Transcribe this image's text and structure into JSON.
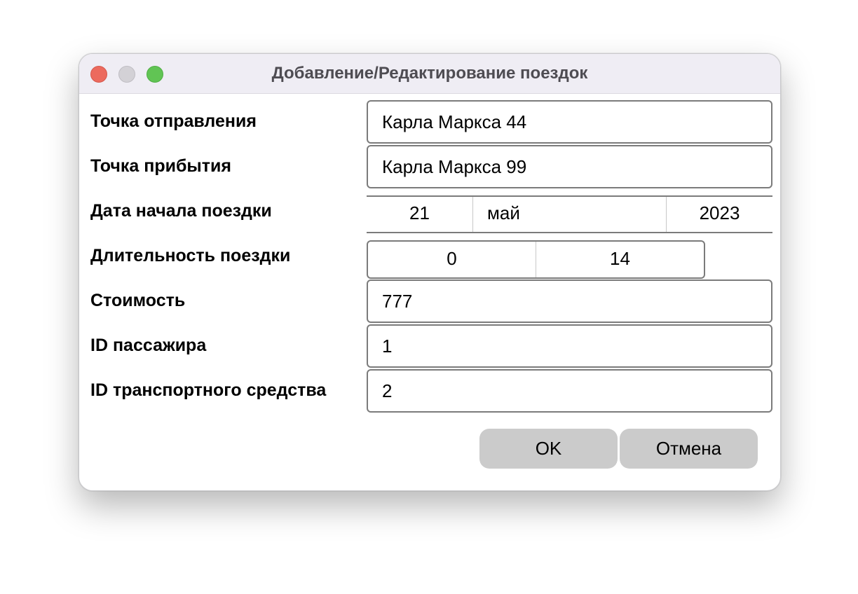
{
  "window": {
    "title": "Добавление/Редактирование поездок"
  },
  "form": {
    "departure": {
      "label": "Точка отправления",
      "value": "Карла Маркса 44"
    },
    "arrival": {
      "label": "Точка прибытия",
      "value": "Карла Маркса 99"
    },
    "start_date": {
      "label": "Дата начала поездки",
      "day": "21",
      "month": "май",
      "year": "2023"
    },
    "duration": {
      "label": "Длительность поездки",
      "first": "0",
      "second": "14"
    },
    "cost": {
      "label": "Стоимость",
      "value": "777"
    },
    "passenger_id": {
      "label": "ID пассажира",
      "value": "1"
    },
    "vehicle_id": {
      "label": "ID транспортного средства",
      "value": "2"
    }
  },
  "buttons": {
    "ok_label": "OK",
    "cancel_label": "Отмена"
  },
  "colors": {
    "titlebar": "#efedf4",
    "close": "#ec6a5e",
    "minimize": "#d3d1d6",
    "zoom": "#61c454",
    "button": "#cbcbcb"
  }
}
